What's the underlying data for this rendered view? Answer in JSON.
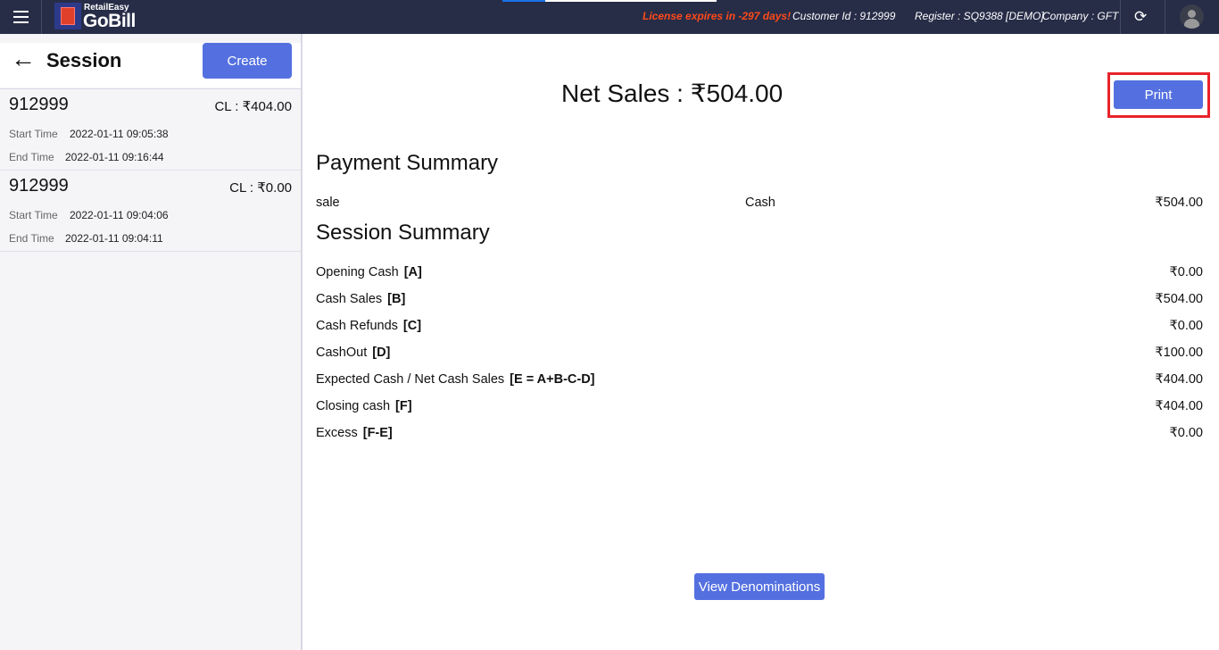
{
  "brand": {
    "line1": "RetailEasy",
    "line2": "GoBill"
  },
  "header": {
    "license": "License expires in -297 days!",
    "customer": "Customer Id : 912999",
    "register": "Register : SQ9388 [DEMO]",
    "company": "Company : GFT",
    "loading_progress": 0.2
  },
  "sidebar": {
    "title": "Session",
    "create_label": "Create",
    "start_label": "Start Time",
    "end_label": "End Time",
    "sessions": [
      {
        "id": "912999",
        "closing": "CL : ₹404.00",
        "start": "2022-01-11 09:05:38",
        "end": "2022-01-11 09:16:44"
      },
      {
        "id": "912999",
        "closing": "CL : ₹0.00",
        "start": "2022-01-11 09:04:06",
        "end": "2022-01-11 09:04:11"
      }
    ]
  },
  "main": {
    "net_sales": "Net Sales : ₹504.00",
    "print_label": "Print",
    "payment_title": "Payment Summary",
    "payment": {
      "type": "sale",
      "method": "Cash",
      "amount": "₹504.00"
    },
    "session_title": "Session Summary",
    "rows": [
      {
        "label": "Opening Cash",
        "code": "[A]",
        "value": "₹0.00"
      },
      {
        "label": "Cash Sales",
        "code": "[B]",
        "value": "₹504.00"
      },
      {
        "label": "Cash Refunds",
        "code": "[C]",
        "value": "₹0.00"
      },
      {
        "label": "CashOut",
        "code": "[D]",
        "value": "₹100.00"
      },
      {
        "label": "Expected Cash / Net Cash Sales",
        "code": "[E = A+B-C-D]",
        "value": "₹404.00"
      },
      {
        "label": "Closing cash",
        "code": "[F]",
        "value": "₹404.00"
      },
      {
        "label": "Excess",
        "code": "[F-E]",
        "value": "₹0.00"
      }
    ],
    "denominations_label": "View Denominations"
  }
}
